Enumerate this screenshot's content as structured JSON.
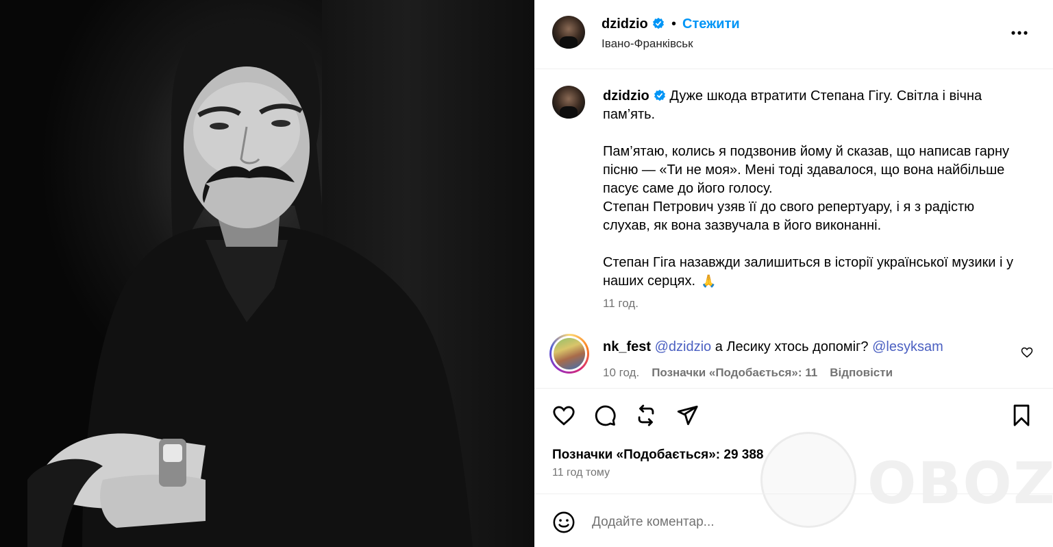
{
  "header": {
    "username": "dzidzio",
    "separator": "•",
    "follow_label": "Стежити",
    "location": "Івано-Франківськ"
  },
  "caption": {
    "username": "dzidzio",
    "paragraph_1": "Дуже шкода втратити Степана Гігу. Світла і вічна пам’ять.",
    "paragraph_2a": "Пам’ятаю, колись я подзвонив йому й сказав, що написав гарну пісню — «Ти не моя». Мені тоді здавалося, що вона найбільше пасує саме до його голосу.",
    "paragraph_2b": "Степан Петрович узяв її до свого репертуару, і я з радістю слухав, як вона зазвучала в його виконанні.",
    "paragraph_3": "Степан Гіга назавжди залишиться в історії української музики і у наших серцях.",
    "emoji": "🙏",
    "time": "11 год."
  },
  "comment": {
    "username": "nk_fest",
    "mention_1": "@dzidzio",
    "text": "а Лесику хтось допоміг?",
    "mention_2": "@lesyksam",
    "time": "10 год.",
    "likes_label": "Позначки «Подобається»: 11",
    "reply_label": "Відповісти"
  },
  "post": {
    "likes_label": "Позначки «Подобається»: 29 388",
    "time_ago": "11 год тому"
  },
  "add_comment": {
    "placeholder": "Додайте коментар..."
  },
  "watermark": {
    "text": "OBOZ.UA"
  },
  "colors": {
    "accent": "#0095f6",
    "mention": "#4a5fc1",
    "secondary_text": "#737373",
    "verified": "#0095f6"
  }
}
